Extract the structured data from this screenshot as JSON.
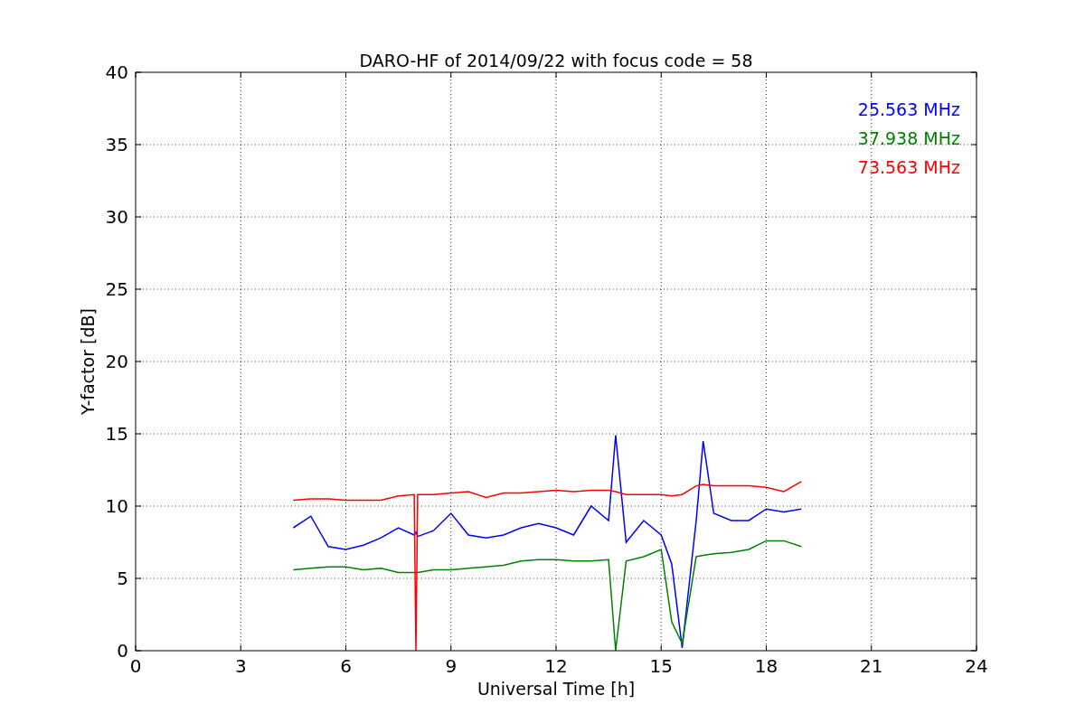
{
  "chart_data": {
    "type": "line",
    "title": "DARO-HF of 2014/09/22 with focus code = 58",
    "xlabel": "Universal Time [h]",
    "ylabel": "Y-factor [dB]",
    "x": [
      4.5,
      5,
      5.5,
      6,
      6.5,
      7,
      7.5,
      7.95,
      8,
      8.05,
      8.5,
      9,
      9.5,
      10,
      10.5,
      11,
      11.5,
      12,
      12.5,
      13,
      13.5,
      13.7,
      14,
      14.5,
      15,
      15.3,
      15.6,
      16,
      16.2,
      16.5,
      17,
      17.5,
      18,
      18.5,
      19
    ],
    "series": [
      {
        "name": "25.563 MHz",
        "color": "#0000ff",
        "values": [
          8.5,
          9.3,
          7.2,
          7,
          7.3,
          7.8,
          8.5,
          8,
          8.2,
          7.9,
          8.3,
          9.5,
          8,
          7.8,
          8,
          8.5,
          8.8,
          8.5,
          8,
          10,
          9,
          14.9,
          7.5,
          9,
          8,
          6,
          0.2,
          9,
          14.5,
          9.5,
          9,
          9,
          9.8,
          9.6,
          9.8
        ]
      },
      {
        "name": "37.938 MHz",
        "color": "#008000",
        "values": [
          5.6,
          5.7,
          5.8,
          5.8,
          5.6,
          5.7,
          5.4,
          5.4,
          5.4,
          5.4,
          5.6,
          5.6,
          5.7,
          5.8,
          5.9,
          6.2,
          6.3,
          6.3,
          6.2,
          6.2,
          6.3,
          0,
          6.2,
          6.5,
          7,
          2,
          0.5,
          6.5,
          6.6,
          6.7,
          6.8,
          7,
          7.6,
          7.6,
          7.2
        ]
      },
      {
        "name": "73.563 MHz",
        "color": "#ff0000",
        "values": [
          10.4,
          10.5,
          10.5,
          10.4,
          10.4,
          10.4,
          10.7,
          10.8,
          0,
          10.8,
          10.8,
          10.9,
          11,
          10.6,
          10.9,
          10.9,
          11,
          11.1,
          11,
          11.1,
          11.1,
          11,
          10.8,
          10.8,
          10.8,
          10.7,
          10.8,
          11.4,
          11.5,
          11.4,
          11.4,
          11.4,
          11.3,
          11,
          11.7
        ]
      }
    ],
    "xlim": [
      0,
      24
    ],
    "ylim": [
      0,
      40
    ],
    "xticks": [
      0,
      3,
      6,
      9,
      12,
      15,
      18,
      21,
      24
    ],
    "yticks": [
      0,
      5,
      10,
      15,
      20,
      25,
      30,
      35,
      40
    ],
    "grid": true
  }
}
